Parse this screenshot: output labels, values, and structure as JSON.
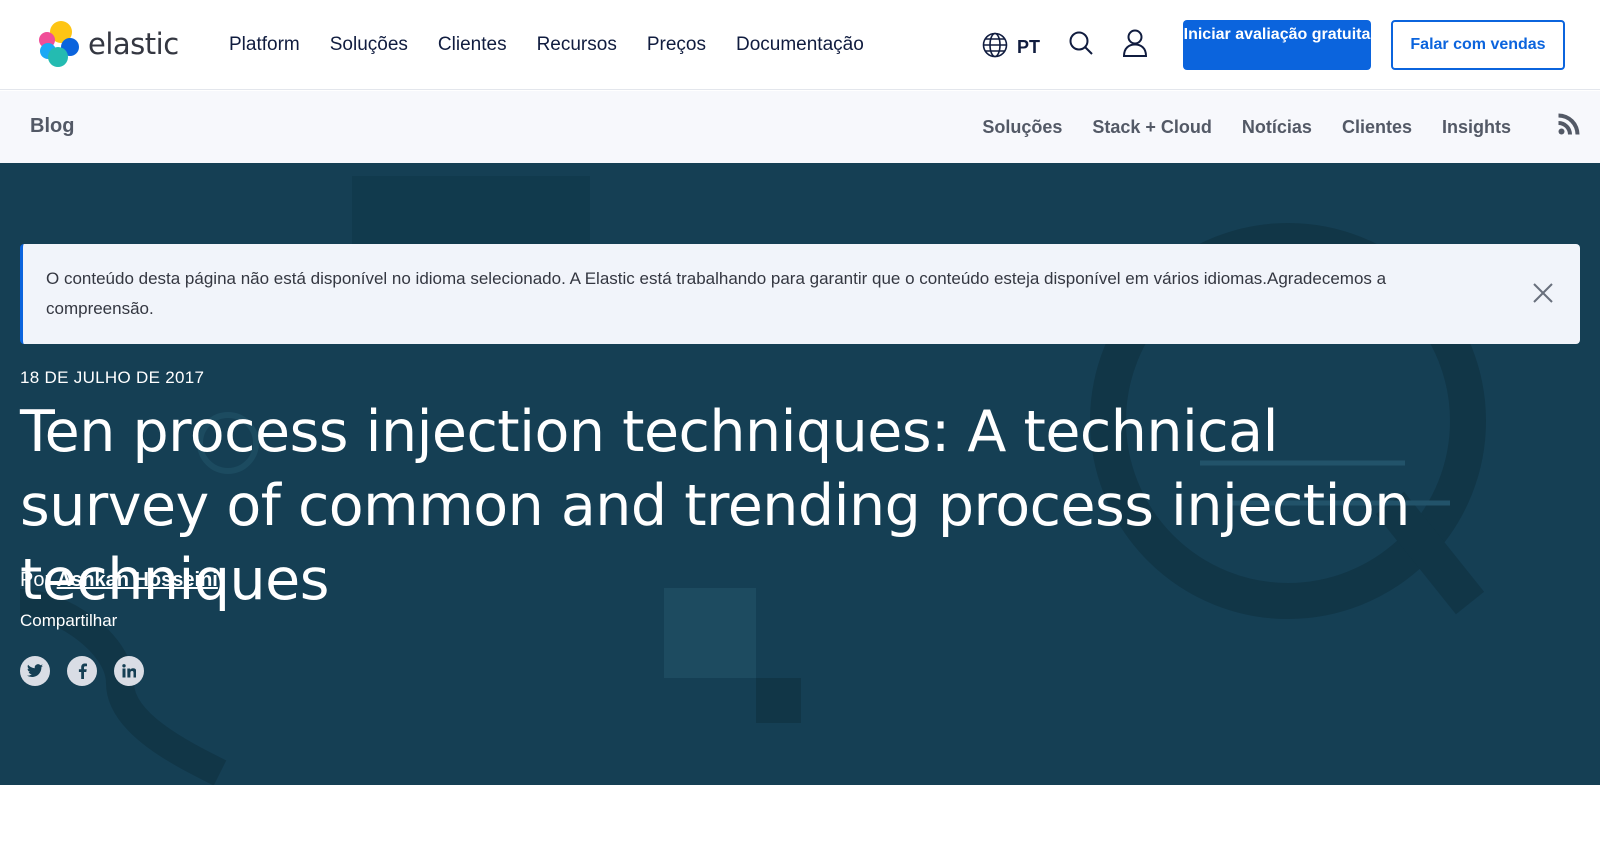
{
  "logo": {
    "text": "elastic"
  },
  "nav": {
    "items": [
      {
        "label": "Platform"
      },
      {
        "label": "Soluções"
      },
      {
        "label": "Clientes"
      },
      {
        "label": "Recursos"
      },
      {
        "label": "Preços"
      },
      {
        "label": "Documentação"
      }
    ],
    "language": "PT",
    "trial_button": "Iniciar avaliação gratuita",
    "sales_button": "Falar com vendas"
  },
  "blog_nav": {
    "title": "Blog",
    "items": [
      {
        "label": "Soluções"
      },
      {
        "label": "Stack + Cloud"
      },
      {
        "label": "Notícias"
      },
      {
        "label": "Clientes"
      },
      {
        "label": "Insights"
      }
    ]
  },
  "notice": {
    "text": "O conteúdo desta página não está disponível no idioma selecionado. A Elastic está trabalhando para garantir que o conteúdo esteja disponível em vários idiomas.Agradecemos a compreensão."
  },
  "post": {
    "date": "18 DE JULHO DE 2017",
    "title": "Ten process injection techniques: A technical survey of common and trending process injection techniques",
    "byline_prefix": "Por",
    "author": "Ashkan Hosseini",
    "share_label": "Compartilhar"
  },
  "share_icons": [
    "twitter-icon",
    "facebook-icon",
    "linkedin-icon"
  ],
  "colors": {
    "accent": "#0b64dd",
    "hero_bg": "#153f54",
    "subnav_bg": "#f7f8fc",
    "notice_bg": "#f1f4fa"
  }
}
